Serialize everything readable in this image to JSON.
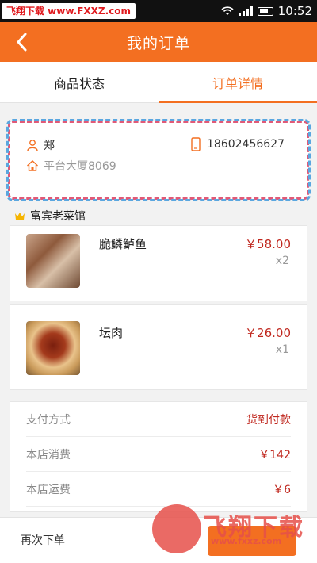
{
  "status_bar": {
    "watermark": "飞翔下载 www.FXXZ.com",
    "time": "10:52"
  },
  "header": {
    "title": "我的订单"
  },
  "tabs": [
    {
      "label": "商品状态",
      "active": false
    },
    {
      "label": "订单详情",
      "active": true
    }
  ],
  "address": {
    "name": "郑",
    "phone": "18602456627",
    "location": "平台大厦8069"
  },
  "shop": {
    "name": "富宾老菜馆"
  },
  "items": [
    {
      "name": "脆鳞鲈鱼",
      "price": "￥58.00",
      "qty": "x2"
    },
    {
      "name": "坛肉",
      "price": "￥26.00",
      "qty": "x1"
    }
  ],
  "summary": [
    {
      "label": "支付方式",
      "value": "货到付款"
    },
    {
      "label": "本店消费",
      "value": "￥142"
    },
    {
      "label": "本店运费",
      "value": "￥6"
    }
  ],
  "footer": {
    "reorder_label": "再次下单"
  },
  "watermark_bottom": {
    "text": "飞翔下载",
    "url": "www.fxxz.com"
  },
  "colors": {
    "accent": "#f36f21",
    "price": "#c0281f"
  }
}
